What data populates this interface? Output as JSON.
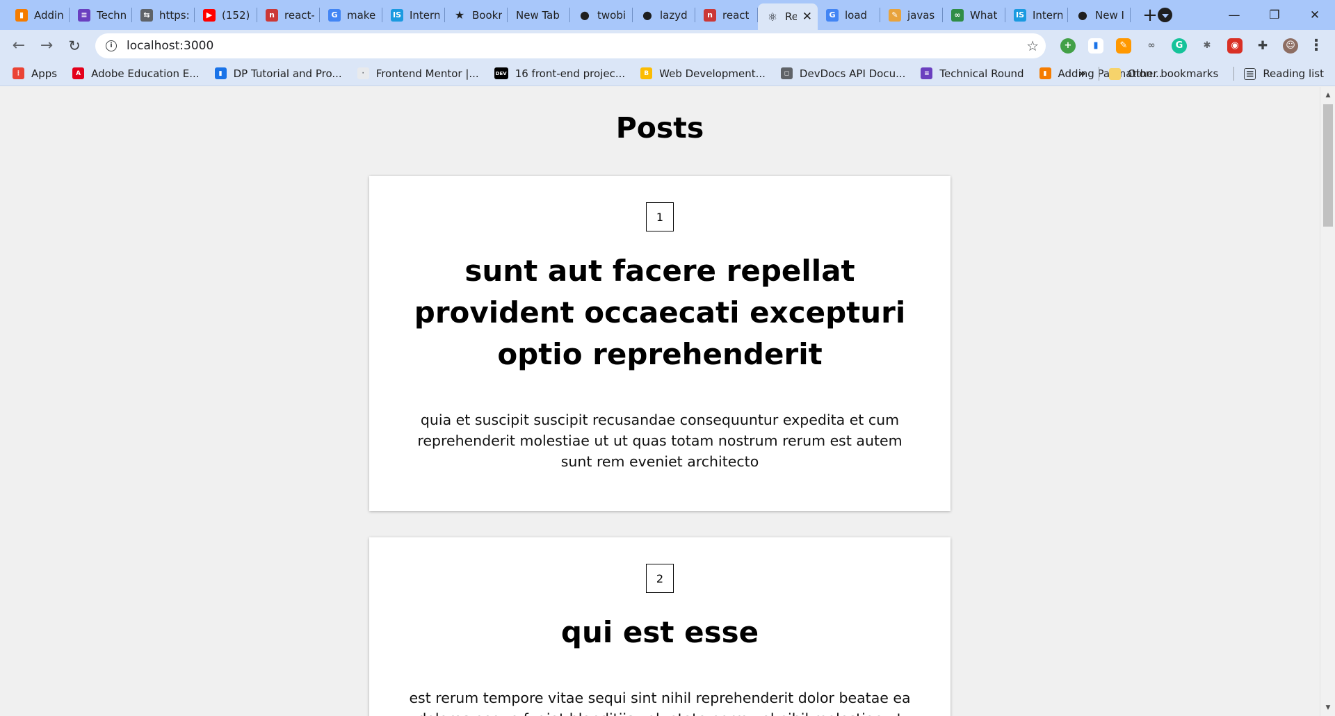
{
  "browser": {
    "tabs": [
      {
        "label": "Addin",
        "icon": "blogger-bookmark-icon",
        "color": "#f57c00",
        "glyph": "▮"
      },
      {
        "label": "Techn",
        "icon": "list-app-icon",
        "color": "#6a3fbf",
        "glyph": "≡"
      },
      {
        "label": "https:",
        "icon": "tab-page-icon",
        "color": "#5f6368",
        "glyph": "⇆"
      },
      {
        "label": "(152)",
        "icon": "youtube-icon",
        "color": "#ff0000",
        "glyph": "▶"
      },
      {
        "label": "react-",
        "icon": "npm-icon",
        "color": "#cb3837",
        "glyph": "n"
      },
      {
        "label": "make",
        "icon": "google-icon",
        "color": "#4285f4",
        "glyph": "G"
      },
      {
        "label": "Intern",
        "icon": "internshala-icon",
        "color": "#1a9ae0",
        "glyph": "IS"
      },
      {
        "label": "Bookr",
        "icon": "star-bookmark-icon",
        "color": "#1f1f1f",
        "glyph": "★"
      },
      {
        "label": "New Tab",
        "icon": "",
        "color": "",
        "glyph": ""
      },
      {
        "label": "twobi",
        "icon": "github-icon",
        "color": "#1f1f1f",
        "glyph": "●"
      },
      {
        "label": "lazyd",
        "icon": "github-icon",
        "color": "#1f1f1f",
        "glyph": "●"
      },
      {
        "label": "react",
        "icon": "npm-icon",
        "color": "#cb3837",
        "glyph": "n"
      },
      {
        "label": "Re",
        "icon": "react-icon",
        "color": "#20232a",
        "glyph": "⚛",
        "active": true
      },
      {
        "label": "load",
        "icon": "google-icon",
        "color": "#4285f4",
        "glyph": "G"
      },
      {
        "label": "javas",
        "icon": "javascript-icon",
        "color": "#e8a33d",
        "glyph": "✎"
      },
      {
        "label": "What",
        "icon": "geeksforgeeks-icon",
        "color": "#2f8d46",
        "glyph": "∞"
      },
      {
        "label": "Intern",
        "icon": "internshala-icon",
        "color": "#1a9ae0",
        "glyph": "IS"
      },
      {
        "label": "New I",
        "icon": "github-icon",
        "color": "#1f1f1f",
        "glyph": "●"
      }
    ],
    "url": "localhost:3000",
    "bookmarks": [
      {
        "label": "Apps",
        "icon": "apps-grid-icon",
        "color": "#ea4335",
        "glyph": "⋮"
      },
      {
        "label": "Adobe Education E...",
        "icon": "adobe-icon",
        "color": "#e3001b",
        "glyph": "A"
      },
      {
        "label": "DP Tutorial and Pro...",
        "icon": "bar-chart-icon",
        "color": "#1a73e8",
        "glyph": "▮"
      },
      {
        "label": "Frontend Mentor |...",
        "icon": "frontend-mentor-icon",
        "color": "#e8eaed",
        "glyph": "·"
      },
      {
        "label": "16 front-end projec...",
        "icon": "dev-icon",
        "color": "#000000",
        "glyph": "DEV"
      },
      {
        "label": "Web Development...",
        "icon": "web-dev-icon",
        "color": "#fbbc04",
        "glyph": "B"
      },
      {
        "label": "DevDocs API Docu...",
        "icon": "devdocs-icon",
        "color": "#5f6368",
        "glyph": "◻"
      },
      {
        "label": "Technical Round",
        "icon": "list-app-icon",
        "color": "#6a3fbf",
        "glyph": "≡"
      },
      {
        "label": "Adding Pagination...",
        "icon": "blogger-bookmark-icon",
        "color": "#f57c00",
        "glyph": "▮"
      }
    ],
    "bookmarks_overflow": "»",
    "other_bookmarks": "Other bookmarks",
    "reading_list": "Reading list"
  },
  "page": {
    "title": "Posts",
    "posts": [
      {
        "id": "1",
        "title": "sunt aut facere repellat provident occaecati excepturi optio reprehenderit",
        "body": "quia et suscipit suscipit recusandae consequuntur expedita et cum reprehenderit molestiae ut ut quas totam nostrum rerum est autem sunt rem eveniet architecto"
      },
      {
        "id": "2",
        "title": "qui est esse",
        "body": "est rerum tempore vitae sequi sint nihil reprehenderit dolor beatae ea dolores neque fugiat blanditiis voluptate porro vel nihil molestiae ut"
      }
    ]
  }
}
